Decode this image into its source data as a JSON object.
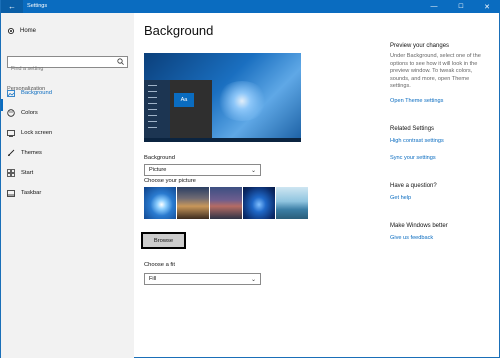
{
  "window": {
    "title": "Settings",
    "back_glyph": "←",
    "min_glyph": "—",
    "max_glyph": "☐",
    "close_glyph": "✕"
  },
  "sidebar": {
    "home_label": "Home",
    "search_placeholder": "Find a setting",
    "section_label": "Personalization",
    "items": [
      {
        "label": "Background",
        "icon": "image-icon",
        "active": true
      },
      {
        "label": "Colors",
        "icon": "palette-icon",
        "active": false
      },
      {
        "label": "Lock screen",
        "icon": "monitor-icon",
        "active": false
      },
      {
        "label": "Themes",
        "icon": "brush-icon",
        "active": false
      },
      {
        "label": "Start",
        "icon": "grid-icon",
        "active": false
      },
      {
        "label": "Taskbar",
        "icon": "taskbar-icon",
        "active": false
      }
    ]
  },
  "main": {
    "title": "Background",
    "preview_tile_text": "Aa",
    "background_label": "Background",
    "background_value": "Picture",
    "choose_picture_label": "Choose your picture",
    "browse_label": "Browse",
    "fit_label": "Choose a fit",
    "fit_value": "Fill"
  },
  "right_panel": {
    "preview_heading": "Preview your changes",
    "preview_text": "Under Background, select one of the options to see how it will look in the preview window. To tweak colors, sounds, and more, open Theme settings.",
    "theme_link": "Open Theme settings",
    "related_heading": "Related Settings",
    "high_contrast_link": "High contrast settings",
    "sync_link": "Sync your settings",
    "question_heading": "Have a question?",
    "help_link": "Get help",
    "better_heading": "Make Windows better",
    "feedback_link": "Give us feedback"
  },
  "colors": {
    "accent": "#0a6cc0",
    "titlebar": "#0a6cc0",
    "sidebar_bg": "#f2f2f2"
  }
}
